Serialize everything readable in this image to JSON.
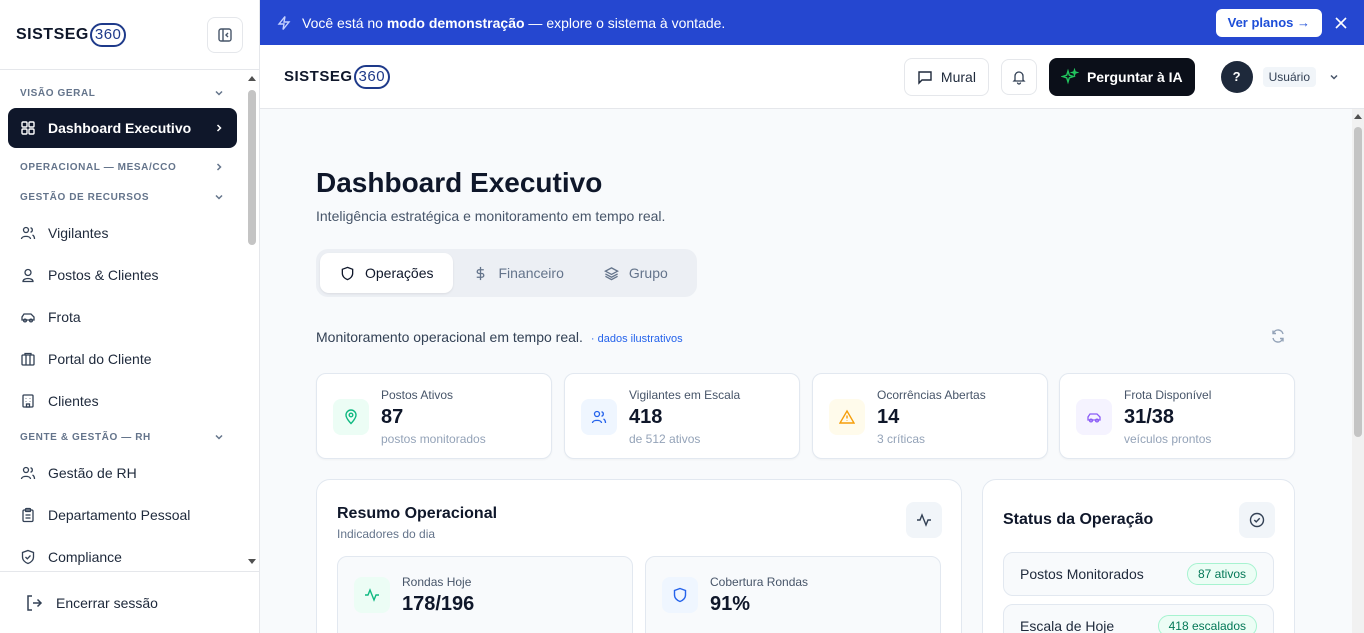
{
  "brand": {
    "name": "SISTSEG",
    "suffix": "360"
  },
  "sidebar": {
    "sections": {
      "visao_geral": "VISÃO GERAL",
      "operacional": "OPERACIONAL — MESA/CCO",
      "gestao_recursos": "GESTÃO DE RECURSOS",
      "gente_gestao": "GENTE & GESTÃO — RH"
    },
    "active_item": "Dashboard Executivo",
    "recursos_items": [
      {
        "label": "Vigilantes",
        "icon": "users-icon"
      },
      {
        "label": "Postos & Clientes",
        "icon": "user-pin-icon"
      },
      {
        "label": "Frota",
        "icon": "car-icon"
      },
      {
        "label": "Portal do Cliente",
        "icon": "store-icon"
      },
      {
        "label": "Clientes",
        "icon": "building-icon"
      }
    ],
    "rh_items": [
      {
        "label": "Gestão de RH",
        "icon": "users-icon"
      },
      {
        "label": "Departamento Pessoal",
        "icon": "clipboard-icon"
      },
      {
        "label": "Compliance",
        "icon": "shield-check-icon"
      }
    ],
    "logout": "Encerrar sessão"
  },
  "banner": {
    "prefix": "Você está no ",
    "bold": "modo demonstração",
    "suffix": " — explore o sistema à vontade.",
    "button": "Ver planos →",
    "color": "#2547d0"
  },
  "topbar": {
    "mural": "Mural",
    "ai_button": "Perguntar à IA",
    "avatar_initial": "?",
    "user": "Usuário"
  },
  "page": {
    "title": "Dashboard Executivo",
    "subtitle": "Inteligência estratégica e monitoramento em tempo real.",
    "tabs": [
      "Operações",
      "Financeiro",
      "Grupo"
    ],
    "monitor_text": "Monitoramento operacional em tempo real.",
    "monitor_tag": "· dados ilustrativos"
  },
  "stats": [
    {
      "label": "Postos Ativos",
      "value": "87",
      "note": "postos monitorados",
      "color": "#10b981"
    },
    {
      "label": "Vigilantes em Escala",
      "value": "418",
      "note": "de 512 ativos",
      "color": "#2563eb"
    },
    {
      "label": "Ocorrências Abertas",
      "value": "14",
      "note": "3 críticas",
      "color": "#f59e0b"
    },
    {
      "label": "Frota Disponível",
      "value": "31/38",
      "note": "veículos prontos",
      "color": "#8b5cf6"
    }
  ],
  "resumo": {
    "title": "Resumo Operacional",
    "subtitle": "Indicadores do dia",
    "cards": [
      {
        "label": "Rondas Hoje",
        "value": "178/196"
      },
      {
        "label": "Cobertura Rondas",
        "value": "91%"
      }
    ]
  },
  "status": {
    "title": "Status da Operação",
    "rows": [
      {
        "label": "Postos Monitorados",
        "badge": "87 ativos"
      },
      {
        "label": "Escala de Hoje",
        "badge": "418 escalados"
      }
    ]
  }
}
